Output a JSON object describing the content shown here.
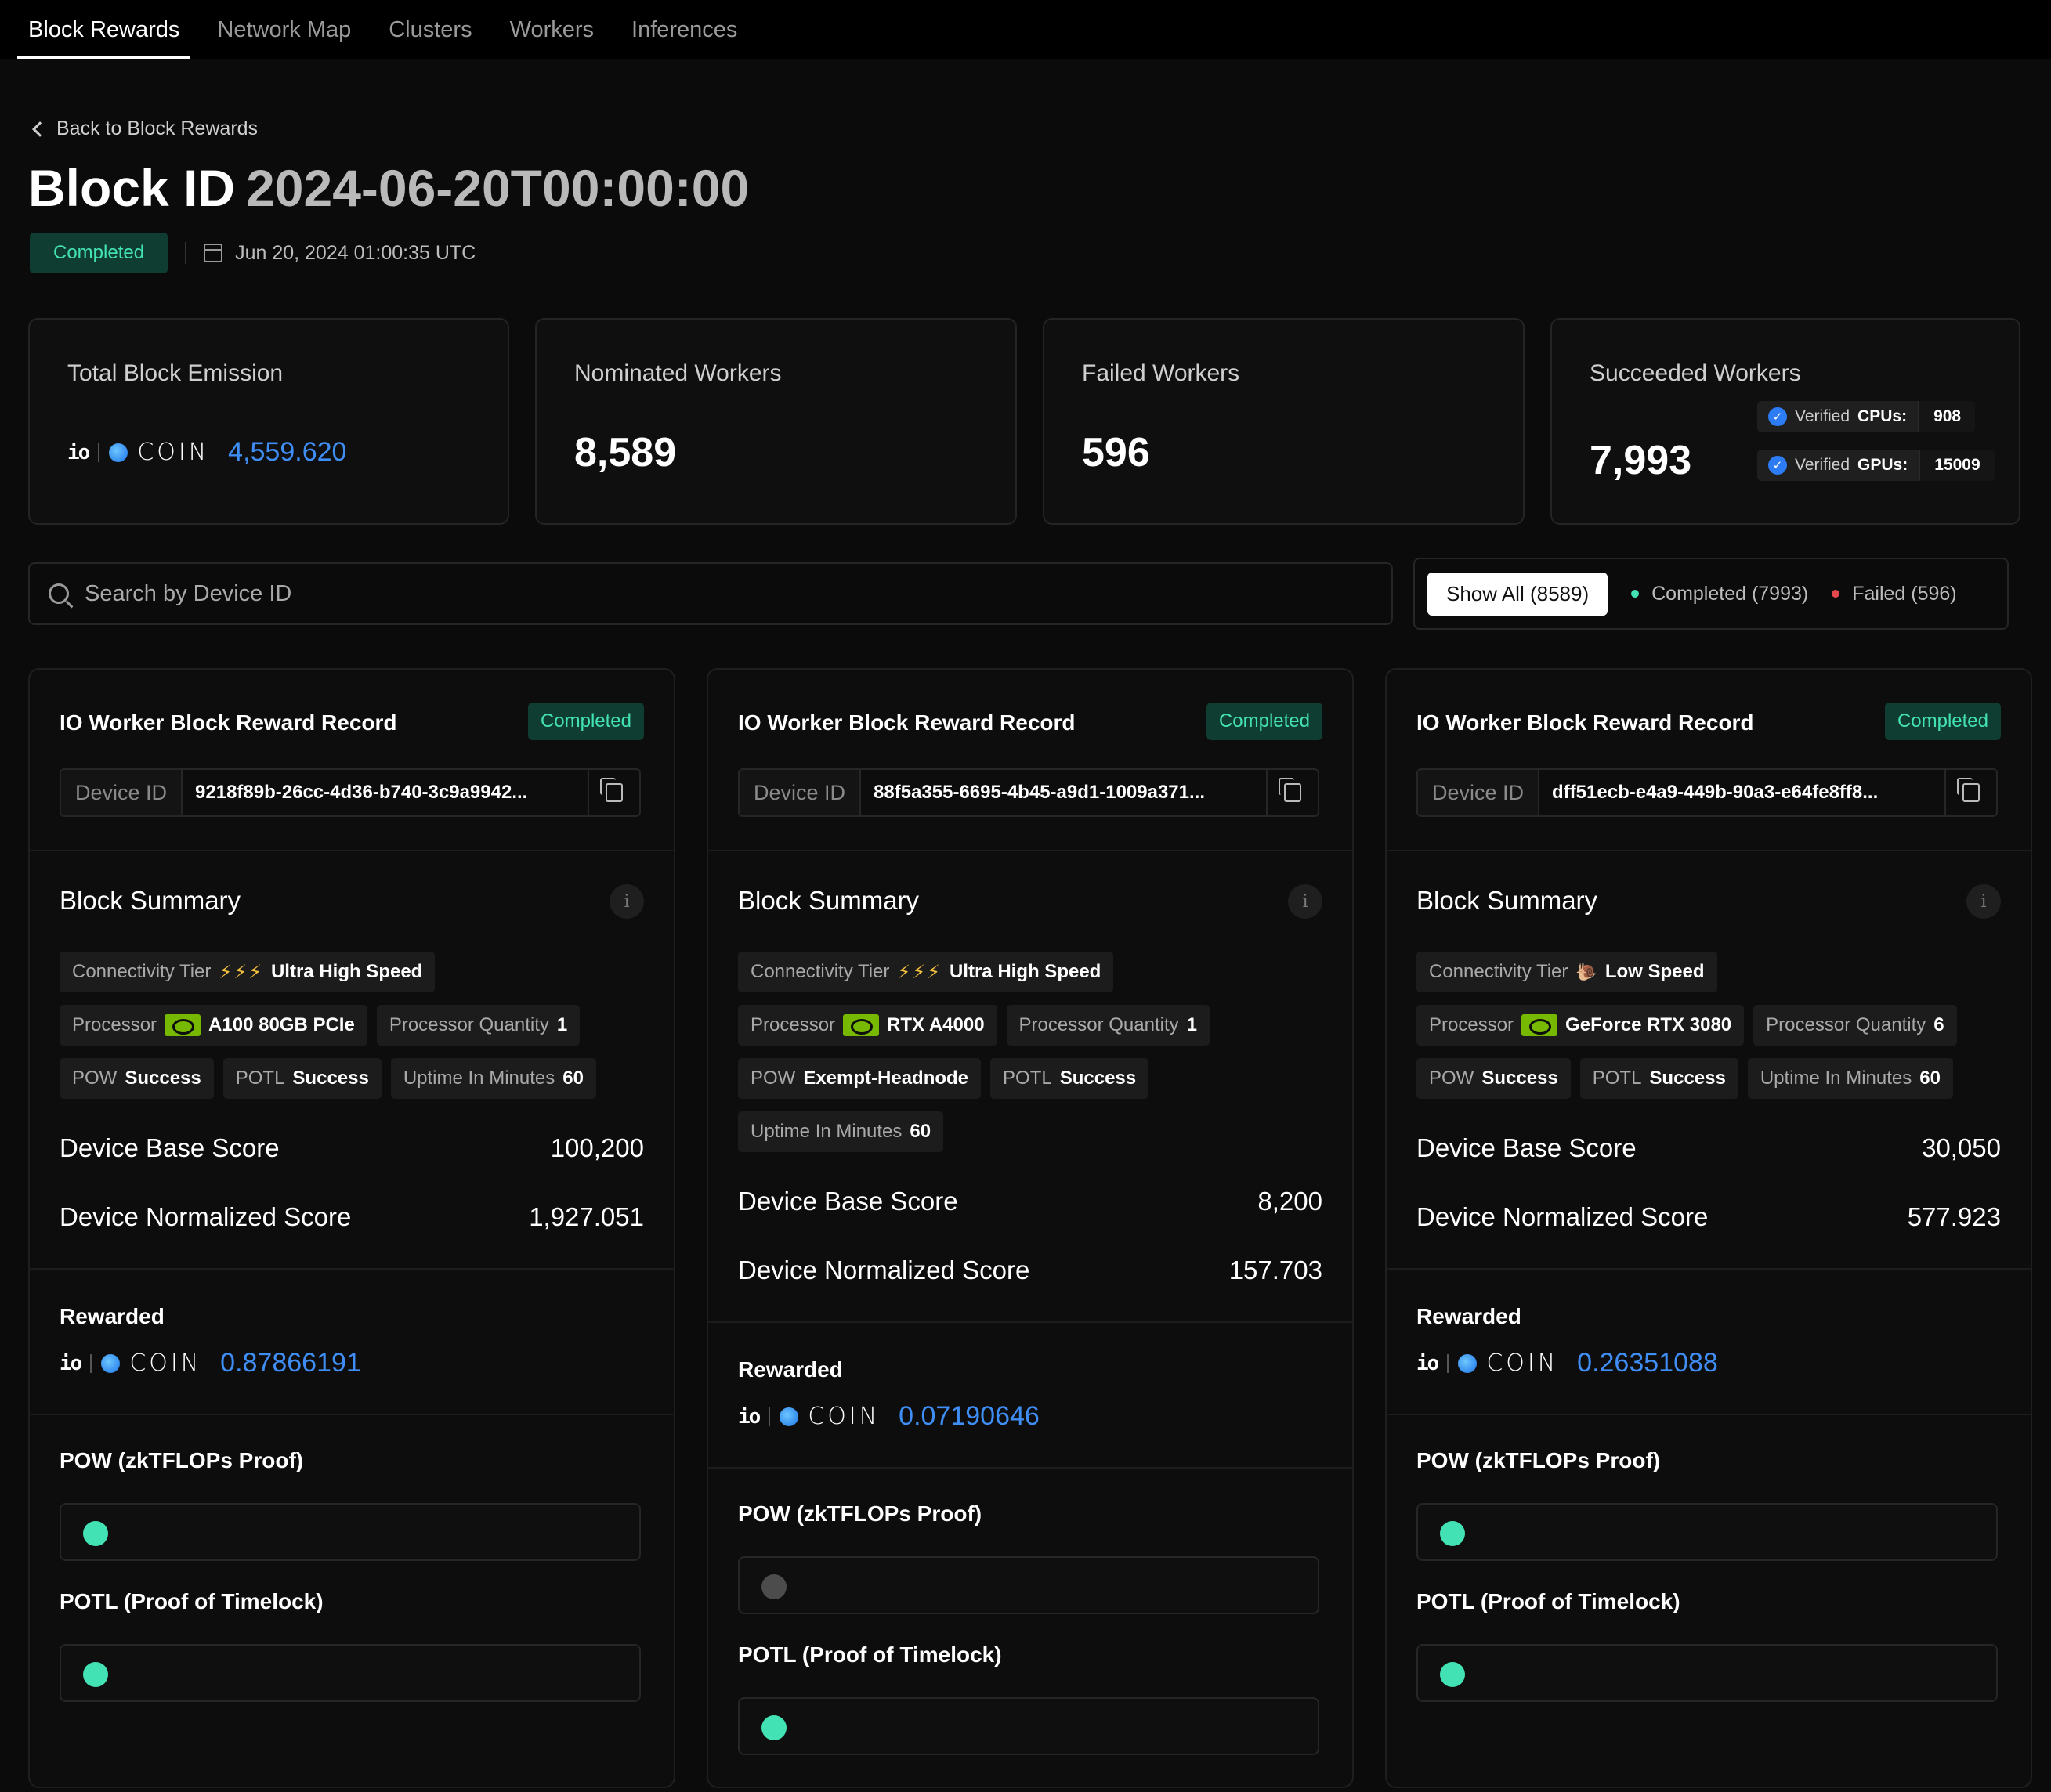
{
  "nav": {
    "tabs": [
      "Block Rewards",
      "Network Map",
      "Clusters",
      "Workers",
      "Inferences"
    ],
    "active": 0
  },
  "header": {
    "back_label": "Back to Block Rewards",
    "title_prefix": "Block ID",
    "block_id": "2024-06-20T00:00:00",
    "status": "Completed",
    "date": "Jun 20, 2024 01:00:35 UTC"
  },
  "stats": {
    "emission": {
      "label": "Total Block Emission",
      "amount": "4,559.620"
    },
    "nominated": {
      "label": "Nominated Workers",
      "value": "8,589"
    },
    "failed": {
      "label": "Failed Workers",
      "value": "596"
    },
    "succeeded": {
      "label": "Succeeded Workers",
      "value": "7,993",
      "cpus_label": "Verified",
      "cpus_key": "CPUs:",
      "cpus": "908",
      "gpus_label": "Verified",
      "gpus_key": "GPUs:",
      "gpus": "15009"
    }
  },
  "coin": {
    "io": "io",
    "name": "COIN"
  },
  "search": {
    "placeholder": "Search by Device ID"
  },
  "filters": {
    "all": "Show All (8589)",
    "completed": "Completed (7993)",
    "failed": "Failed (596)",
    "completed_color": "#43e2b4",
    "failed_color": "#e5484d"
  },
  "labels": {
    "card_title": "IO Worker Block Reward Record",
    "device_id": "Device ID",
    "block_summary": "Block Summary",
    "connectivity": "Connectivity Tier",
    "processor": "Processor",
    "processor_qty": "Processor Quantity",
    "pow": "POW",
    "potl": "POTL",
    "uptime": "Uptime In Minutes",
    "base_score": "Device Base Score",
    "norm_score": "Device Normalized Score",
    "rewarded": "Rewarded",
    "pow_proof": "POW (zkTFLOPs Proof)",
    "potl_proof": "POTL (Proof of Timelock)",
    "info": "i"
  },
  "cards": [
    {
      "status": "Completed",
      "device_id": "9218f89b-26cc-4d36-b740-3c9a9942...",
      "tier_icon": "⚡⚡⚡",
      "tier": "Ultra High Speed",
      "processor": "A100 80GB PCIe",
      "qty": "1",
      "pow": "Success",
      "potl": "Success",
      "uptime": "60",
      "base_score": "100,200",
      "norm_score": "1,927.051",
      "reward": "0.87866191",
      "pow_state": "success",
      "potl_state": "success"
    },
    {
      "status": "Completed",
      "device_id": "88f5a355-6695-4b45-a9d1-1009a371...",
      "tier_icon": "⚡⚡⚡",
      "tier": "Ultra High Speed",
      "processor": "RTX A4000",
      "qty": "1",
      "pow": "Exempt-Headnode",
      "potl": "Success",
      "uptime": "60",
      "base_score": "8,200",
      "norm_score": "157.703",
      "reward": "0.07190646",
      "pow_state": "exempt",
      "potl_state": "success"
    },
    {
      "status": "Completed",
      "device_id": "dff51ecb-e4a9-449b-90a3-e64fe8ff8...",
      "tier_icon": "🐌",
      "tier": "Low Speed",
      "processor": "GeForce RTX 3080",
      "qty": "6",
      "pow": "Success",
      "potl": "Success",
      "uptime": "60",
      "base_score": "30,050",
      "norm_score": "577.923",
      "reward": "0.26351088",
      "pow_state": "success",
      "potl_state": "success"
    }
  ]
}
